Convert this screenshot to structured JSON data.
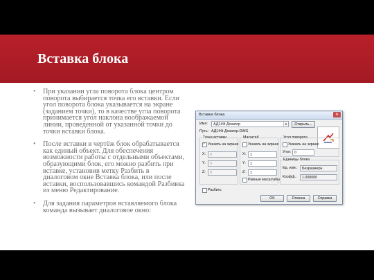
{
  "slide": {
    "title": "Вставка блока",
    "bullets": [
      "При указании угла поворота блока центром поворота выбирается точка его вставки. Если угол поворота блока указывается на экране (заданием точки), то в качестве угла поворота принимается угол наклона воображаемой линии, проведенной от указанной точки до точки вставки блока.",
      "После вставки в чертёж блок обрабатывается как единый объект. Для обеспечения возможности работы с отдельными объектами, образующими блок, его можно разбить при вставке, установив метку Разбить в диалоговом окне Вставка блока, или после вставки, воспользовавшись командой Разбивка из меню Редактирование.",
      "Для задания параметров вставляемого блока команда вызывает диалоговое окно:"
    ]
  },
  "dialog": {
    "title": "Вставка блока",
    "close_glyph": "✕",
    "name_label": "Имя:",
    "name_value": "АД14Ф-Дозатор",
    "browse_button": "Открыть...",
    "path_label": "Путь:",
    "path_value": "АД14Ф-Дозатор.DWG",
    "groups": {
      "insertion": {
        "title": "Точка вставки",
        "on_screen": "Указать на экране",
        "on_screen_checked": true,
        "x_label": "X:",
        "x_value": "0",
        "y_label": "Y:",
        "y_value": "0",
        "z_label": "Z:",
        "z_value": "0"
      },
      "scale": {
        "title": "Масштаб",
        "on_screen": "Указать на экране",
        "on_screen_checked": false,
        "x_label": "X:",
        "x_value": "1",
        "y_label": "Y:",
        "y_value": "1",
        "z_label": "Z:",
        "z_value": "1",
        "uniform": "Равные масштабы",
        "uniform_checked": false
      },
      "rotation": {
        "title": "Угол поворота",
        "on_screen": "Указать на экране",
        "on_screen_checked": false,
        "angle_label": "Угол:",
        "angle_value": "0"
      },
      "block_units": {
        "title": "Единицы блока",
        "units_label": "Ед. изм.:",
        "units_value": "Безразмерн.",
        "factor_label": "Коэфф.:",
        "factor_value": "1.000000"
      }
    },
    "explode_label": "Разбить",
    "explode_checked": false,
    "ok_button": "OK",
    "cancel_button": "Отмена",
    "help_button": "Справка"
  },
  "colors": {
    "banner": "#b8202a",
    "text": "#6b6b6b",
    "frame": "#000000"
  }
}
